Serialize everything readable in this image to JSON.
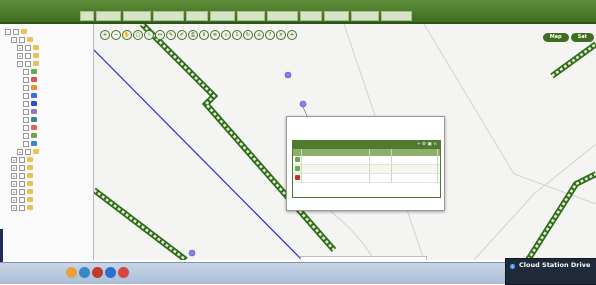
{
  "app": {
    "logo_text": "",
    "menu_items": [
      "",
      "",
      "",
      "",
      "",
      "",
      "",
      "",
      "",
      "",
      "",
      ""
    ]
  },
  "sidebar": {
    "items": [
      {
        "label": "",
        "depth": 0,
        "color": "#e8c35a",
        "expander": "-"
      },
      {
        "label": "",
        "depth": 1,
        "color": "#e8c35a",
        "expander": "-"
      },
      {
        "label": "",
        "depth": 2,
        "color": "#e8c35a",
        "expander": "+"
      },
      {
        "label": "",
        "depth": 2,
        "color": "#e8c35a",
        "expander": "+"
      },
      {
        "label": "",
        "depth": 2,
        "color": "#e8c35a",
        "expander": "-"
      },
      {
        "label": "",
        "depth": 3,
        "color": "#6aa84f",
        "expander": ""
      },
      {
        "label": "",
        "depth": 3,
        "color": "#d9534f",
        "expander": ""
      },
      {
        "label": "",
        "depth": 3,
        "color": "#e69138",
        "expander": ""
      },
      {
        "label": "",
        "depth": 3,
        "color": "#3d6fd6",
        "expander": ""
      },
      {
        "label": "",
        "depth": 3,
        "color": "#2b4fc9",
        "expander": "",
        "selected": true
      },
      {
        "label": "",
        "depth": 3,
        "color": "#8e7cc3",
        "expander": ""
      },
      {
        "label": "",
        "depth": 3,
        "color": "#45818e",
        "expander": ""
      },
      {
        "label": "",
        "depth": 3,
        "color": "#e06666",
        "expander": ""
      },
      {
        "label": "",
        "depth": 3,
        "color": "#6aa84f",
        "expander": ""
      },
      {
        "label": "",
        "depth": 3,
        "color": "#3d85c6",
        "expander": ""
      },
      {
        "label": "",
        "depth": 2,
        "color": "#e8c35a",
        "expander": "+"
      },
      {
        "label": "",
        "depth": 1,
        "color": "#e8c35a",
        "expander": "+"
      },
      {
        "label": "",
        "depth": 1,
        "color": "#e8c35a",
        "expander": "+"
      },
      {
        "label": "",
        "depth": 1,
        "color": "#e8c35a",
        "expander": "+"
      },
      {
        "label": "",
        "depth": 1,
        "color": "#e8c35a",
        "expander": "+"
      },
      {
        "label": "",
        "depth": 1,
        "color": "#e8c35a",
        "expander": "+"
      },
      {
        "label": "",
        "depth": 1,
        "color": "#e8c35a",
        "expander": "+"
      },
      {
        "label": "",
        "depth": 1,
        "color": "#e8c35a",
        "expander": "+"
      }
    ]
  },
  "toolbar": {
    "icons": [
      "zoom-in",
      "zoom-out",
      "pan",
      "select",
      "identify",
      "measure",
      "draw",
      "edit",
      "print",
      "info",
      "layers",
      "search",
      "export",
      "refresh",
      "home",
      "help",
      "clear",
      "add"
    ],
    "glyphs": [
      "+",
      "−",
      "✋",
      "▢",
      "i",
      "↔",
      "✎",
      "✐",
      "⎙",
      "ℹ",
      "≡",
      "⌕",
      "⇩",
      "↻",
      "⌂",
      "?",
      "×",
      "+"
    ]
  },
  "map": {
    "view_buttons": [
      "Map",
      "Sat"
    ],
    "scale_text": "",
    "status_text": ""
  },
  "popup": {
    "info_lines": [
      "",
      "",
      ""
    ],
    "panel_title": "",
    "columns": [
      "",
      "",
      "",
      ""
    ],
    "rows": [
      {
        "status_color": "#6aa84f",
        "c1": "",
        "c2": "",
        "c3": "",
        "c4": ""
      },
      {
        "status_color": "#6aa84f",
        "c1": "",
        "c2": "",
        "c3": "",
        "c4": ""
      },
      {
        "status_color": "#cc2a2a",
        "c1": "",
        "c2": "",
        "c3": "",
        "c4": ""
      }
    ]
  },
  "taskbar": {
    "pinned_text": "",
    "tray_text": ""
  },
  "notification": {
    "title": "Cloud Station Drive",
    "subtitle": ""
  },
  "colors": {
    "brand_green": "#3e6d22",
    "road_green": "#2f6a1b",
    "blue_line": "#1f2fd6",
    "marker": "#8a80e6"
  }
}
